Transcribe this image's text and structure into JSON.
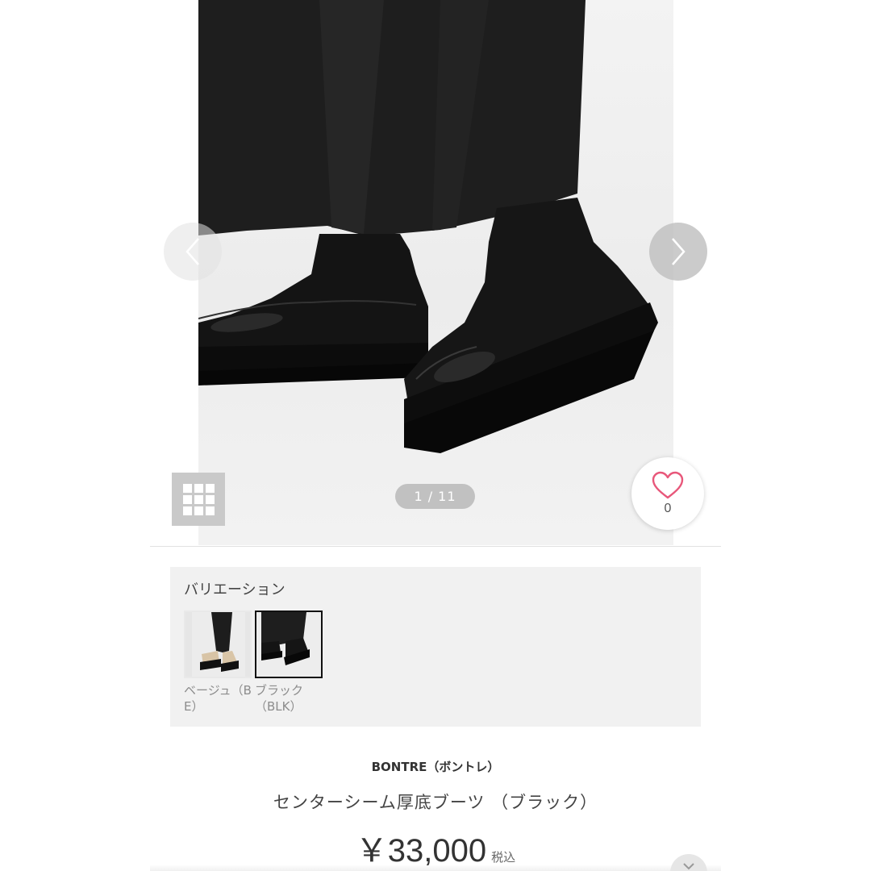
{
  "gallery": {
    "counter": "1 / 11",
    "prev_icon": "chevron-left-icon",
    "next_icon": "chevron-right-icon",
    "grid_icon": "grid-icon"
  },
  "favorite": {
    "icon": "heart-icon",
    "count": "0",
    "accent": "#e8577a"
  },
  "variation": {
    "title": "バリエーション",
    "items": [
      {
        "label": "ベージュ（BE）",
        "selected": false
      },
      {
        "label": "ブラック（BLK）",
        "selected": true
      }
    ]
  },
  "product": {
    "brand": "BONTRE（ボントレ）",
    "name": "センターシーム厚底ブーツ （ブラック）",
    "price": "￥33,000",
    "tax_label": "税込"
  }
}
